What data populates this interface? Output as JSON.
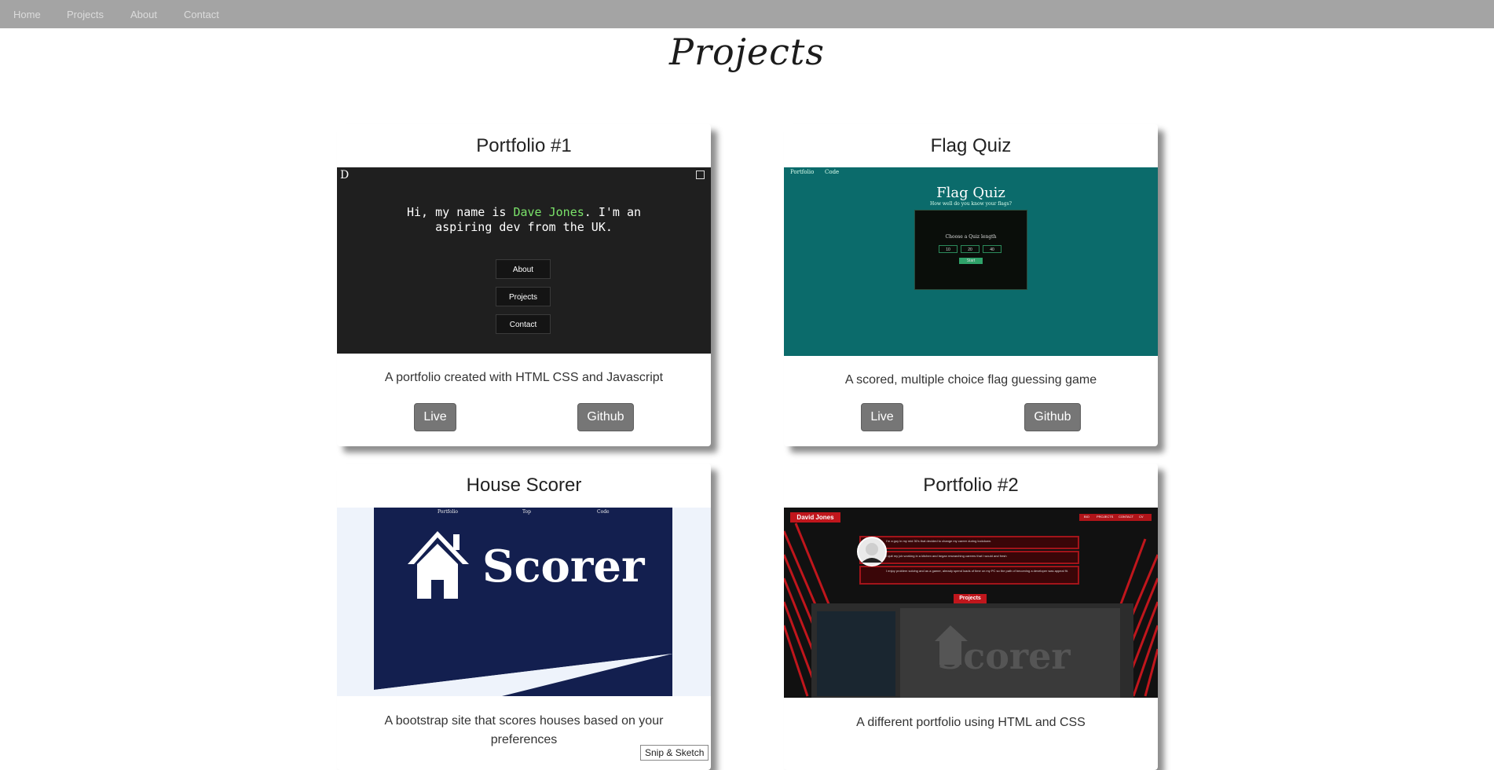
{
  "nav": {
    "items": [
      {
        "label": "Home"
      },
      {
        "label": "Projects"
      },
      {
        "label": "About"
      },
      {
        "label": "Contact"
      }
    ]
  },
  "page_title": "Projects",
  "cards": [
    {
      "title": "Portfolio #1",
      "description": "A portfolio created with HTML CSS and Javascript",
      "live_label": "Live",
      "github_label": "Github",
      "preview": {
        "logo": "D",
        "intro_pre": "Hi, my name is ",
        "intro_name": "Dave Jones",
        "intro_post": ". I'm an",
        "intro_line2": "aspiring dev from the UK.",
        "buttons": [
          "About",
          "Projects",
          "Contact"
        ],
        "name_color": "#7be36a"
      }
    },
    {
      "title": "Flag Quiz",
      "description": "A scored, multiple choice flag guessing game",
      "live_label": "Live",
      "github_label": "Github",
      "preview": {
        "nav": [
          "Portfolio",
          "Code"
        ],
        "title": "Flag Quiz",
        "subtitle": "How well do you know your flags?",
        "prompt": "Choose a Quiz length",
        "options": [
          "10",
          "20",
          "40"
        ],
        "start": "Start",
        "bg_color": "#0b6b6b"
      }
    },
    {
      "title": "House Scorer",
      "description": "A bootstrap site that scores houses based on your preferences",
      "preview": {
        "nav": [
          "Portfolio",
          "Top",
          "Code"
        ],
        "logo_text": "Scorer",
        "bg_color": "#131f4f"
      }
    },
    {
      "title": "Portfolio #2",
      "description": "A different portfolio using HTML and CSS",
      "preview": {
        "brand": "David Jones",
        "nav": [
          "BIO",
          "PROJECTS",
          "CONTACT",
          "CV"
        ],
        "bio": [
          "I'm a guy in my mid 30's that decided to change my career during lockdown.",
          "I quit my job working in a kitchen and began researching careers that I would and fresh",
          "I enjoy problem solving and as a gamer, already spend loads of time on my PC so the path of becoming a developer was appeal fit."
        ],
        "projects_label": "Projects",
        "logo_text": "Scorer",
        "accent": "#c0161c"
      }
    }
  ],
  "overlay": {
    "snip_label": "Snip & Sketch"
  }
}
